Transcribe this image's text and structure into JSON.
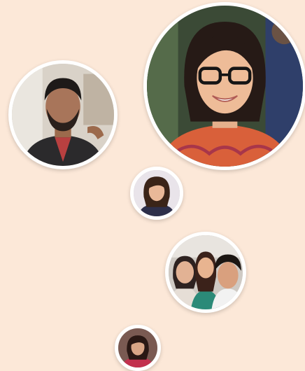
{
  "background_color": "#fce8d8",
  "avatars": [
    {
      "id": "man",
      "icon": "user-photo"
    },
    {
      "id": "woman",
      "icon": "user-photo"
    },
    {
      "id": "small1",
      "icon": "user-photo"
    },
    {
      "id": "group",
      "icon": "group-photo"
    },
    {
      "id": "small2",
      "icon": "user-photo"
    }
  ]
}
